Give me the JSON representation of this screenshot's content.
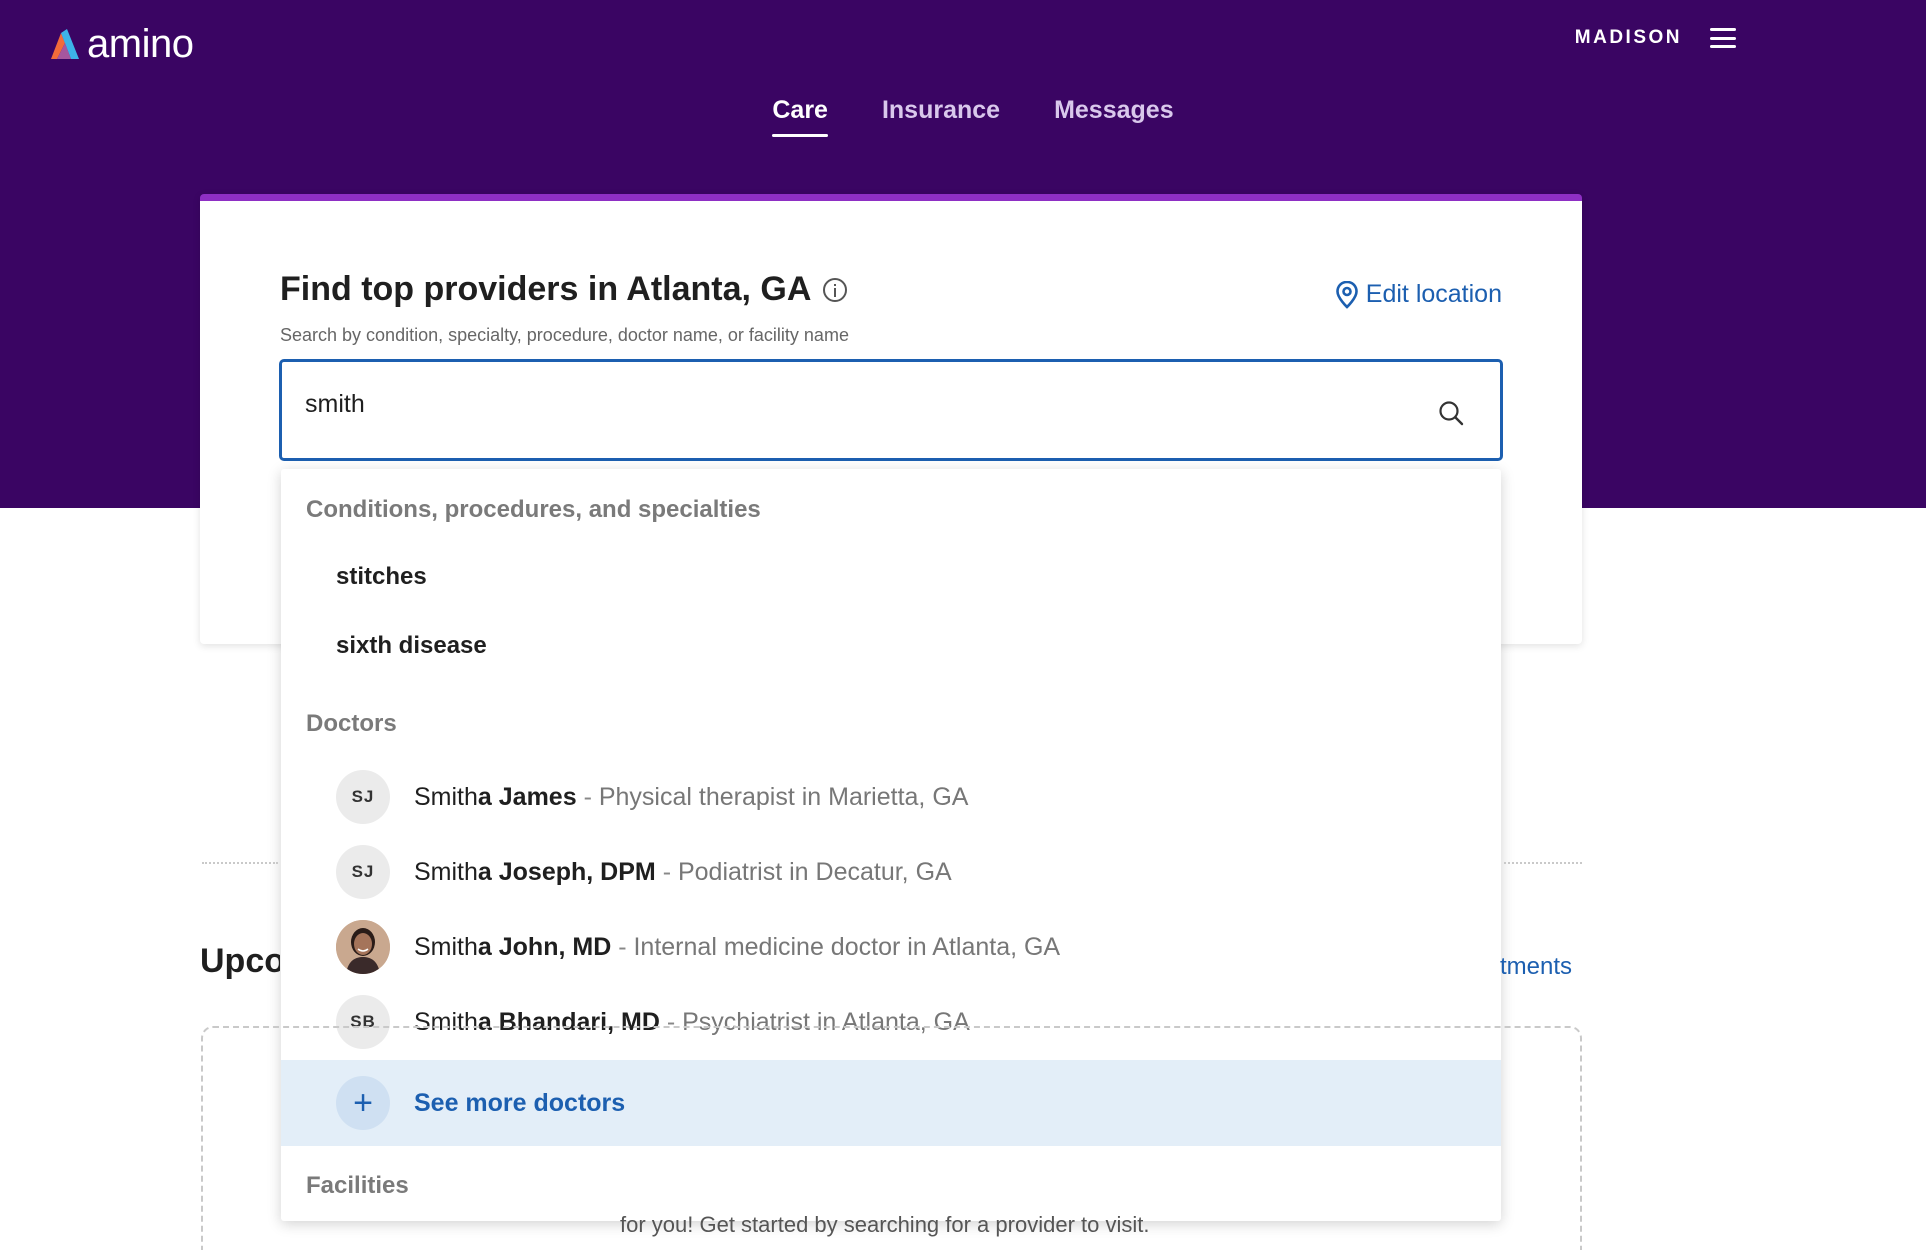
{
  "app": {
    "logo_text": "amino"
  },
  "header": {
    "user_name": "MADISON",
    "tabs": [
      {
        "label": "Care",
        "active": true
      },
      {
        "label": "Insurance",
        "active": false
      },
      {
        "label": "Messages",
        "active": false
      }
    ]
  },
  "search_card": {
    "title": "Find top providers in Atlanta, GA",
    "edit_location_label": "Edit location",
    "subtitle": "Search by condition, specialty, procedure, doctor name, or facility name",
    "query": "smith"
  },
  "dropdown": {
    "conditions_heading": "Conditions, procedures, and specialties",
    "conditions": [
      "stitches",
      "sixth disease"
    ],
    "doctors_heading": "Doctors",
    "doctors": [
      {
        "initials": "SJ",
        "match": "Smith",
        "rest": "a James",
        "desc": "Physical therapist in Marietta, GA",
        "photo": false
      },
      {
        "initials": "SJ",
        "match": "Smith",
        "rest": "a Joseph, DPM",
        "desc": "Podiatrist in Decatur, GA",
        "photo": false
      },
      {
        "initials": "",
        "match": "Smith",
        "rest": "a John, MD",
        "desc": "Internal medicine doctor in Atlanta, GA",
        "photo": true
      },
      {
        "initials": "SB",
        "match": "Smith",
        "rest": "a Bhandari, MD",
        "desc": "Psychiatrist in Atlanta, GA",
        "photo": false
      }
    ],
    "separator": "-",
    "see_more_label": "See more doctors",
    "facilities_heading": "Facilities"
  },
  "background": {
    "upcoming_fragment": "Upco",
    "appointments_fragment": "tments",
    "empty_state_fragment": "for you! Get started by searching for a provider to visit."
  },
  "colors": {
    "header_bg": "#3a0563",
    "accent_blue": "#1c5fb0",
    "card_top_border": "#8e2fc4",
    "see_more_bg": "#e3eef8"
  }
}
